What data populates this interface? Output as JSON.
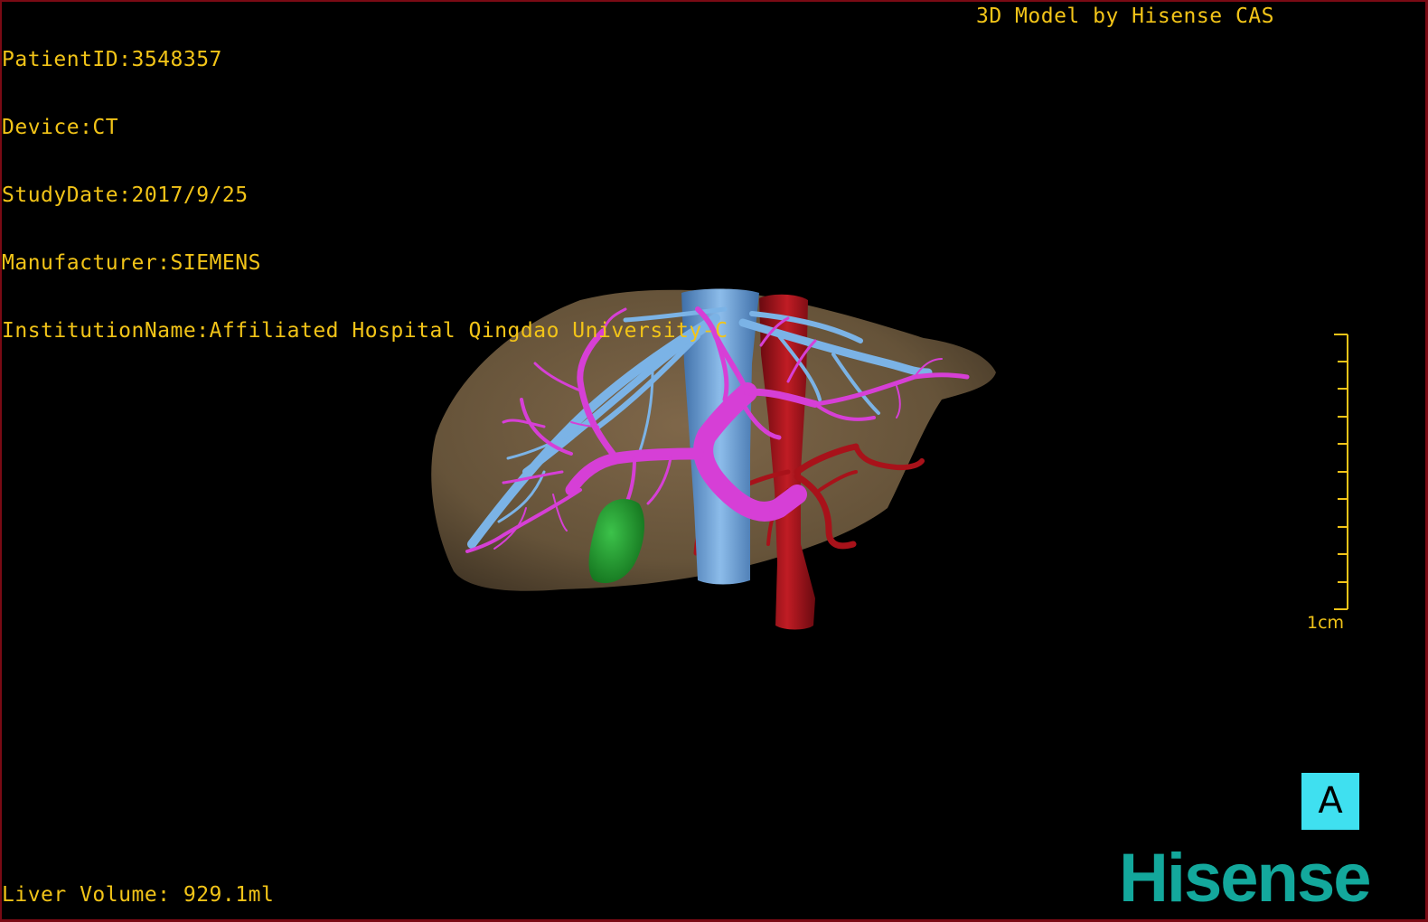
{
  "patient_info": {
    "patient_id": "PatientID:3548357",
    "device": "Device:CT",
    "study_date": "StudyDate:2017/9/25",
    "manufacturer": "Manufacturer:SIEMENS",
    "institution": "InstitutionName:Affiliated Hospital Qingdao University-C"
  },
  "header_right": "3D Model by Hisense CAS",
  "liver_volume": "Liver Volume: 929.1ml",
  "scale": {
    "label": "1cm"
  },
  "orientation_marker": "A",
  "brand_logo": "Hisense",
  "colors": {
    "overlay_text": "#f2c418",
    "liver": "#7a6448",
    "hepatic_vein": "#6fa8dc",
    "portal_vein": "#d63fd6",
    "artery_and_ivc": "#a8121a",
    "gallbladder": "#1f9e2a",
    "orientation_box": "#3fe0f0",
    "brand": "#13a89c",
    "frame": "#7a0a14"
  },
  "model_structures": [
    "liver",
    "hepatic-vein",
    "portal-vein",
    "aorta",
    "hepatic-artery",
    "gallbladder"
  ]
}
